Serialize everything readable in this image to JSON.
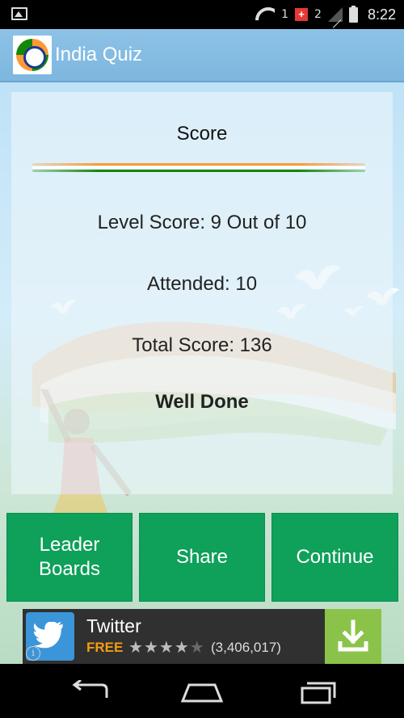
{
  "status_bar": {
    "time": "8:22",
    "sim1": "1",
    "sim2": "2",
    "icons": [
      "gallery-notification-icon",
      "wifi-icon",
      "sim1-icon",
      "swiss-flag-icon",
      "sim2-icon",
      "signal-icon",
      "battery-icon"
    ]
  },
  "app_bar": {
    "title": "India Quiz",
    "logo": "india-quiz-logo",
    "color": "#8dc2e6"
  },
  "score_card": {
    "title": "Score",
    "level_score": "Level Score: 9 Out of 10",
    "attended": "Attended:  10",
    "total_score": "Total Score: 136",
    "message": "Well Done"
  },
  "buttons": {
    "leader_boards_line1": "Leader",
    "leader_boards_line2": "Boards",
    "share": "Share",
    "continue": "Continue",
    "color": "#0fa05a"
  },
  "ad": {
    "app_name": "Twitter",
    "price": "FREE",
    "rating": 4,
    "rating_max": 5,
    "reviews": "(3,406,017)",
    "icon": "twitter-bird-icon",
    "install_icon": "download-icon"
  },
  "nav_bar": {
    "icons": [
      "back-icon",
      "home-icon",
      "recent-apps-icon"
    ]
  }
}
